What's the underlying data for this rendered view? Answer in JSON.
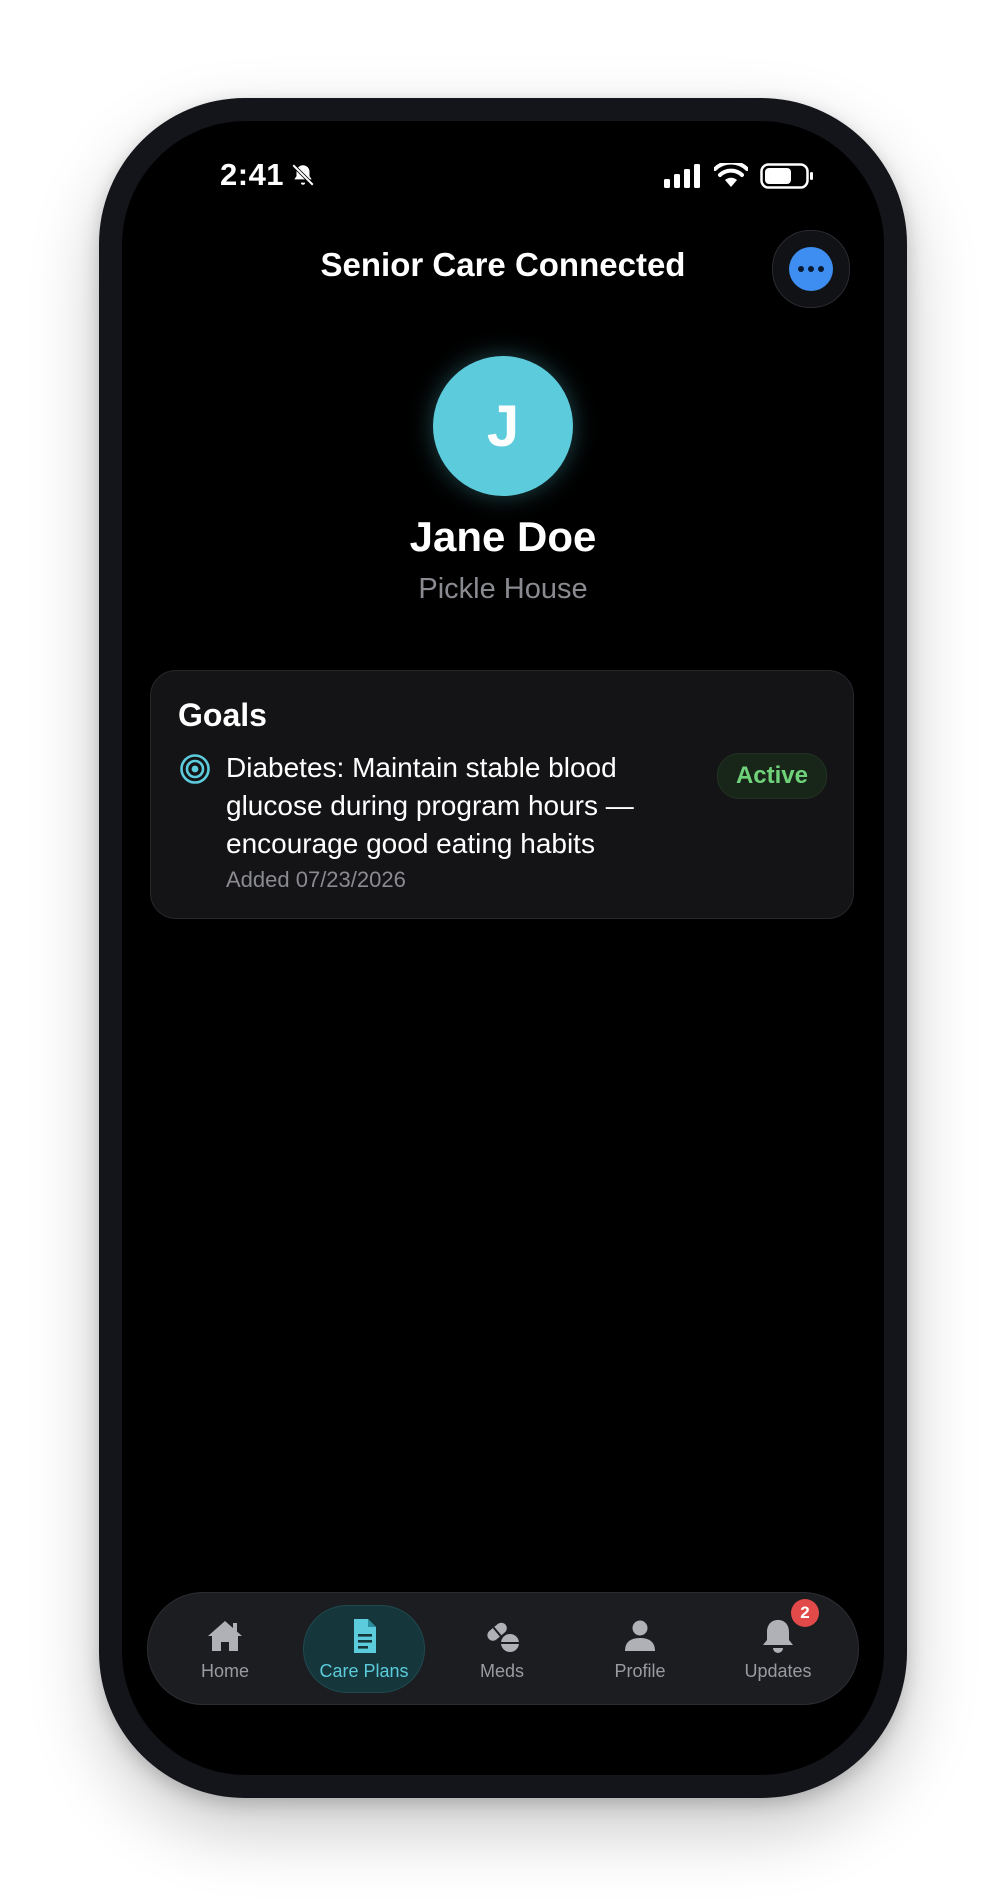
{
  "status_bar": {
    "time": "2:41",
    "icons": [
      "bell-slash-icon",
      "signal-icon",
      "wifi-icon",
      "battery-icon"
    ]
  },
  "header": {
    "title": "Senior Care Connected",
    "more_icon": "ellipsis-icon"
  },
  "profile": {
    "initial": "J",
    "name": "Jane Doe",
    "location": "Pickle House",
    "avatar_color": "#5ccbdc"
  },
  "goals": {
    "title": "Goals",
    "items": [
      {
        "icon": "target-icon",
        "text": "Diabetes: Maintain stable blood glucose during program hours — encourage good eating habits",
        "added": "Added 07/23/2026",
        "status": "Active"
      }
    ]
  },
  "tab_bar": {
    "active": "Care Plans",
    "tabs": [
      {
        "label": "Home",
        "icon": "house-icon"
      },
      {
        "label": "Care Plans",
        "icon": "document-icon"
      },
      {
        "label": "Meds",
        "icon": "pills-icon"
      },
      {
        "label": "Profile",
        "icon": "person-icon"
      },
      {
        "label": "Updates",
        "icon": "bell-icon",
        "badge": "2"
      }
    ]
  },
  "colors": {
    "accent": "#5ccbdc",
    "more_button": "#3d8ef0",
    "active_status": "#6fd17a",
    "badge": "#e24a4a"
  }
}
